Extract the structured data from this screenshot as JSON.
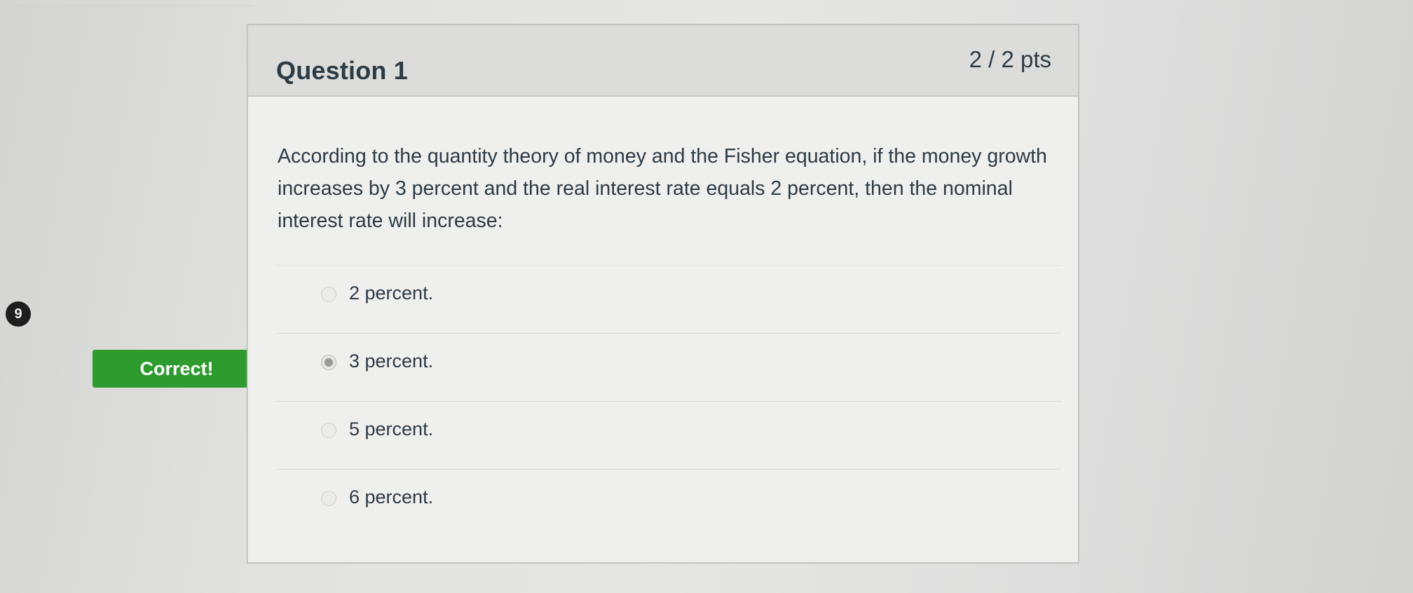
{
  "question": {
    "title": "Question 1",
    "points": "2 / 2 pts",
    "text": "According to the quantity theory of money and the Fisher equation, if the money growth increases by 3 percent and the real interest rate equals 2 percent, then the nominal interest rate will increase:",
    "answers": [
      {
        "label": "2 percent.",
        "selected": false
      },
      {
        "label": "3 percent.",
        "selected": true
      },
      {
        "label": "5 percent.",
        "selected": false
      },
      {
        "label": "6 percent.",
        "selected": false
      }
    ]
  },
  "feedback": {
    "correct_label": "Correct!",
    "color": "#2e9b2e"
  },
  "side_badge": {
    "number": "9"
  }
}
